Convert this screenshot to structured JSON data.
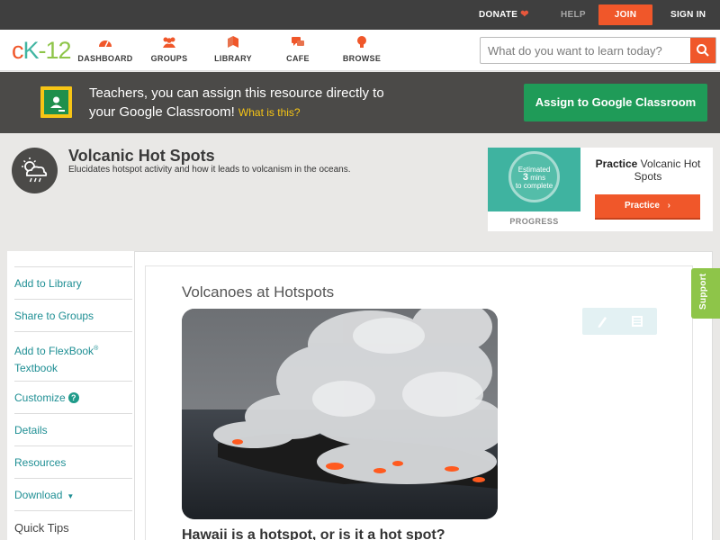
{
  "topbar": {
    "donate": "DONATE",
    "help": "HELP",
    "join": "JOIN",
    "signin": "SIGN IN",
    "accent": "#f0572a"
  },
  "brand": {
    "logo_c": "c",
    "logo_k": "K",
    "logo_dash": "-",
    "logo_num": "12"
  },
  "nav": {
    "items": [
      {
        "label": "DASHBOARD",
        "icon": "dashboard-gauge-icon"
      },
      {
        "label": "GROUPS",
        "icon": "groups-people-icon"
      },
      {
        "label": "LIBRARY",
        "icon": "library-books-icon"
      },
      {
        "label": "CAFE",
        "icon": "cafe-chat-icon"
      },
      {
        "label": "BROWSE",
        "icon": "browse-lightbulb-icon"
      }
    ],
    "search_placeholder": "What do you want to learn today?",
    "icon_color": "#f0572a"
  },
  "banner": {
    "text_line1": "Teachers, you can assign this resource directly to",
    "text_line2": "your Google Classroom!",
    "what_link": "What is this?",
    "assign_button": "Assign to Google Classroom",
    "button_color": "#1f9b58"
  },
  "resource": {
    "title": "Volcanic Hot Spots",
    "description": "Elucidates hotspot activity and how it leads to volcanism in the oceans.",
    "icon": "weather-cloud-sun-rain-icon"
  },
  "practice": {
    "estimated": "Estimated",
    "mins": "3",
    "mins_unit": "mins",
    "to_complete": "to complete",
    "progress_label": "PROGRESS",
    "title_bold": "Practice",
    "title_rest": "Volcanic Hot Spots",
    "button": "Practice"
  },
  "sidebar": {
    "items": [
      {
        "label": "Add to Library"
      },
      {
        "label": "Share to Groups"
      },
      {
        "label": "Add to FlexBook",
        "sup": "®",
        "label2": "Textbook"
      },
      {
        "label": "Customize",
        "badge": "?"
      },
      {
        "label": "Details"
      },
      {
        "label": "Resources"
      },
      {
        "label": "Download",
        "caret": "▼"
      },
      {
        "label": "Quick Tips"
      }
    ],
    "link_color": "#1f8f94"
  },
  "article": {
    "heading": "Volcanoes at Hotspots",
    "subheading": "Hawaii is a hotspot, or is it a hot spot?",
    "image_alt": "lava flowing into ocean with steam clouds"
  },
  "support": {
    "label": "Support"
  }
}
